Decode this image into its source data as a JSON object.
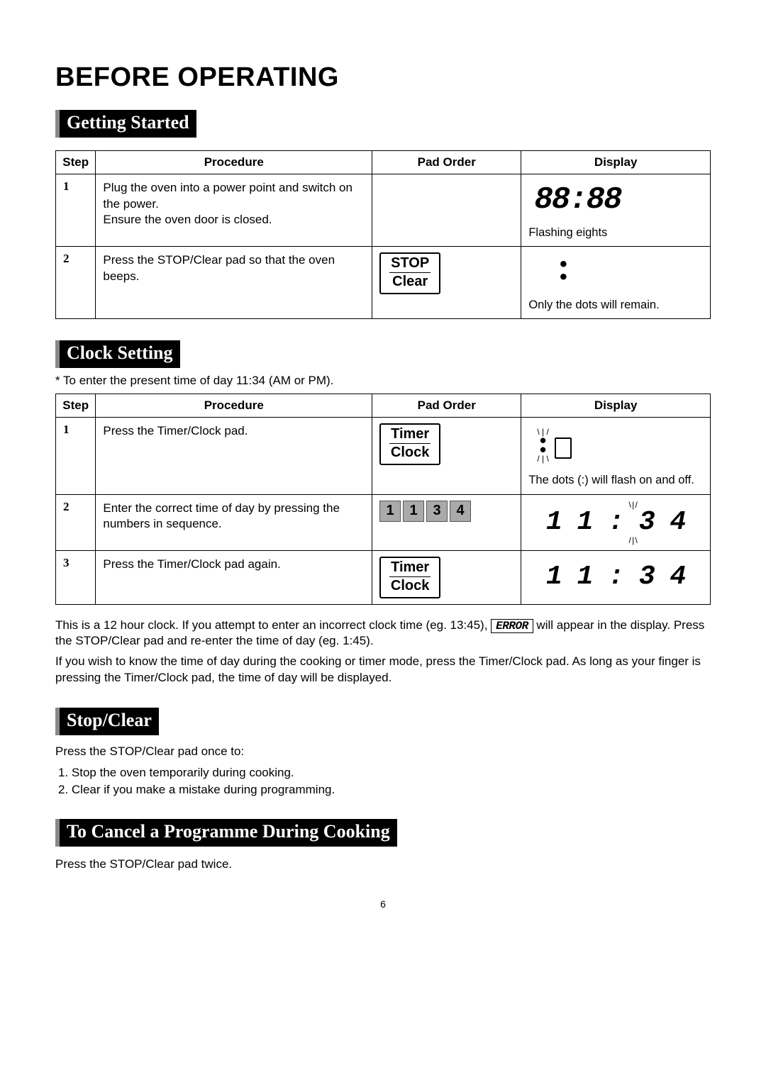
{
  "title": "BEFORE OPERATING",
  "getting_started": {
    "label": "Getting Started",
    "headers": {
      "step": "Step",
      "procedure": "Procedure",
      "pad_order": "Pad Order",
      "display": "Display"
    },
    "rows": [
      {
        "n": "1",
        "procedure": "Plug the oven into a power point and switch on the power.\nEnsure the oven door is closed.",
        "display_seg": "88:88",
        "display_caption": "Flashing  eights"
      },
      {
        "n": "2",
        "procedure": "Press the STOP/Clear pad so that the oven beeps.",
        "pad_line1": "STOP",
        "pad_line2": "Clear",
        "display_caption": "Only the dots will remain."
      }
    ]
  },
  "clock_setting": {
    "label": "Clock Setting",
    "pre_note": "* To enter the present time of day 11:34 (AM or PM).",
    "headers": {
      "step": "Step",
      "procedure": "Procedure",
      "pad_order": "Pad Order",
      "display": "Display"
    },
    "rows": [
      {
        "n": "1",
        "procedure": "Press the Timer/Clock pad.",
        "pad_line1": "Timer",
        "pad_line2": "Clock",
        "display_caption": "The dots (:) will flash on and off."
      },
      {
        "n": "2",
        "procedure": "Enter the correct  time of day  by pressing the numbers in sequence.",
        "keys": [
          "1",
          "1",
          "3",
          "4"
        ],
        "display_seg": "1 1 : 3 4"
      },
      {
        "n": "3",
        "procedure": "Press the Timer/Clock pad again.",
        "pad_line1": "Timer",
        "pad_line2": "Clock",
        "display_seg": "1 1 : 3 4"
      }
    ],
    "note_part1": "This is a 12 hour clock. If you attempt to enter an incorrect clock time (eg. 13:45), ",
    "note_err": "ERROR",
    "note_part2": " will appear in the display. Press the STOP/Clear pad and re-enter the time of day (eg. 1:45).",
    "note_part3": "If you wish to know the time of day during the cooking or timer mode, press the Timer/Clock pad. As long as your finger is pressing the Timer/Clock pad, the time of day will be displayed."
  },
  "stop_clear": {
    "label": "Stop/Clear",
    "intro": "Press the STOP/Clear pad once to:",
    "item1": "1.  Stop the oven temporarily during cooking.",
    "item2": "2.  Clear if you make a mistake during programming."
  },
  "cancel": {
    "label": "To Cancel a Programme During Cooking",
    "body": "Press the STOP/Clear pad twice."
  },
  "page": "6"
}
